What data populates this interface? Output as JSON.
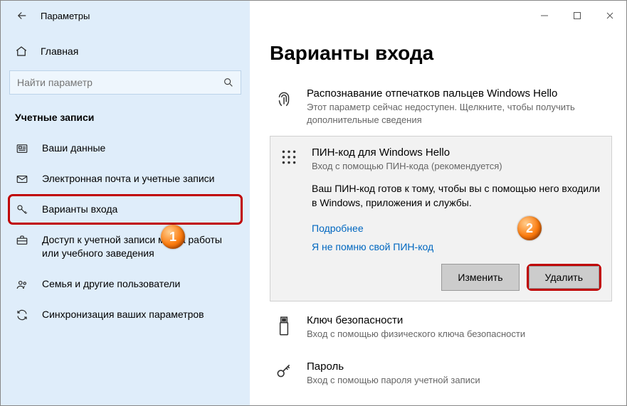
{
  "window": {
    "title": "Параметры"
  },
  "search": {
    "placeholder": "Найти параметр"
  },
  "sidebar": {
    "home": "Главная",
    "section": "Учетные записи",
    "items": [
      {
        "label": "Ваши данные"
      },
      {
        "label": "Электронная почта и учетные записи"
      },
      {
        "label": "Варианты входа"
      },
      {
        "label": "Доступ к учетной записи места работы или учебного заведения"
      },
      {
        "label": "Семья и другие пользователи"
      },
      {
        "label": "Синхронизация ваших параметров"
      }
    ]
  },
  "page": {
    "title": "Варианты входа",
    "fingerprint": {
      "title": "Распознавание отпечатков пальцев Windows Hello",
      "sub": "Этот параметр сейчас недоступен. Щелкните, чтобы получить дополнительные сведения"
    },
    "pin": {
      "title": "ПИН-код для Windows Hello",
      "sub": "Вход с помощью ПИН-кода (рекомендуется)",
      "desc": "Ваш ПИН-код готов к тому, чтобы вы с помощью него входили в Windows, приложения и службы.",
      "more": "Подробнее",
      "forgot": "Я не помню свой ПИН-код",
      "change": "Изменить",
      "remove": "Удалить"
    },
    "seckey": {
      "title": "Ключ безопасности",
      "sub": "Вход с помощью физического ключа безопасности"
    },
    "password": {
      "title": "Пароль",
      "sub": "Вход с помощью пароля учетной записи"
    }
  },
  "badges": {
    "one": "1",
    "two": "2"
  }
}
